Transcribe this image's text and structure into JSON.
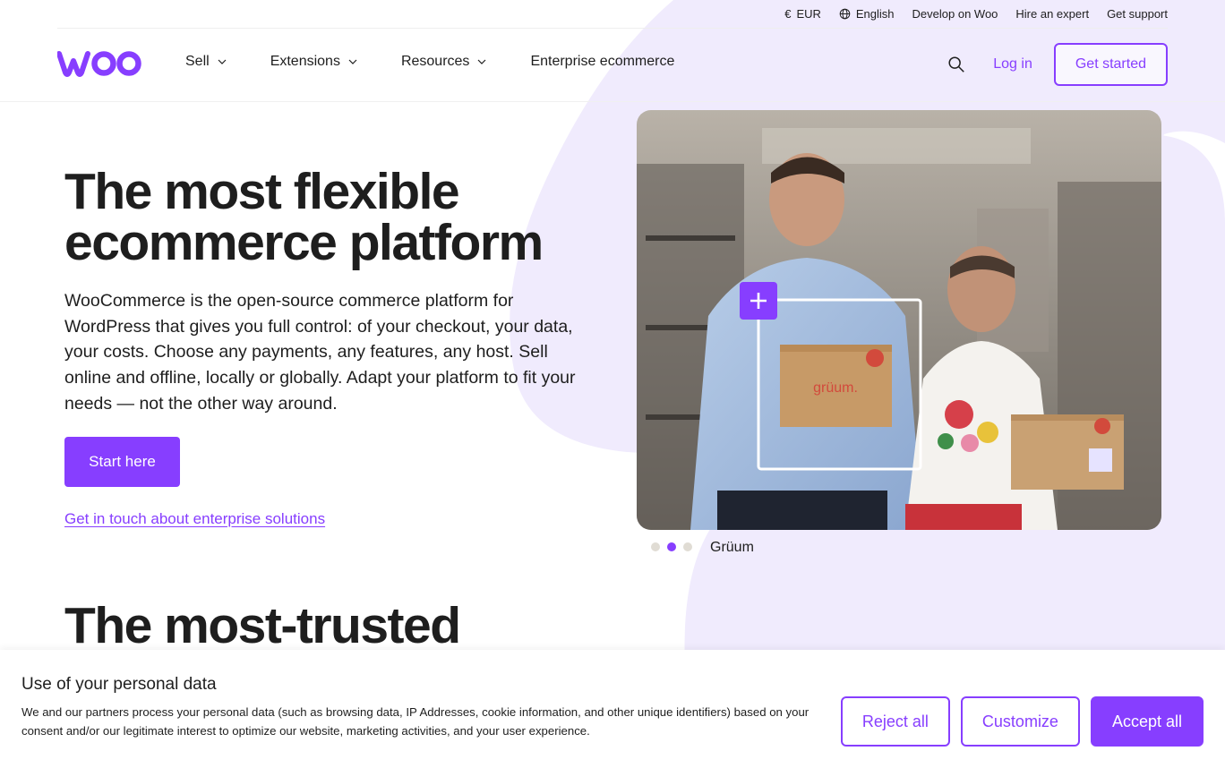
{
  "colors": {
    "brand": "#873eff",
    "text": "#1e1e1e",
    "blob": "#f0ebfd"
  },
  "utility": {
    "currency": "EUR",
    "language": "English",
    "develop": "Develop on Woo",
    "hire": "Hire an expert",
    "support": "Get support"
  },
  "nav": {
    "logo_text": "woo",
    "items": [
      {
        "label": "Sell",
        "has_dropdown": true
      },
      {
        "label": "Extensions",
        "has_dropdown": true
      },
      {
        "label": "Resources",
        "has_dropdown": true
      },
      {
        "label": "Enterprise ecommerce",
        "has_dropdown": false
      }
    ],
    "login": "Log in",
    "get_started": "Get started"
  },
  "hero": {
    "title": "The most flexible ecommerce platform",
    "description": "WooCommerce is the open-source commerce platform for WordPress that gives you full control: of your checkout, your data, your costs. Choose any payments, any features, any host. Sell online and offline, locally or globally. Adapt your platform to fit your needs — not the other way around.",
    "cta": "Start here",
    "secondary_link": "Get in touch about enterprise solutions",
    "image_caption": "Grüum",
    "box_brand": "grüum.",
    "active_slide": 2,
    "slide_count": 3
  },
  "section": {
    "title": "The most-trusted"
  },
  "cookie": {
    "title": "Use of your personal data",
    "text": "We and our partners process your personal data (such as browsing data, IP Addresses, cookie information, and other unique identifiers) based on your consent and/or our legitimate interest to optimize our website, marketing activities, and your user experience.",
    "reject": "Reject all",
    "customize": "Customize",
    "accept": "Accept all"
  }
}
